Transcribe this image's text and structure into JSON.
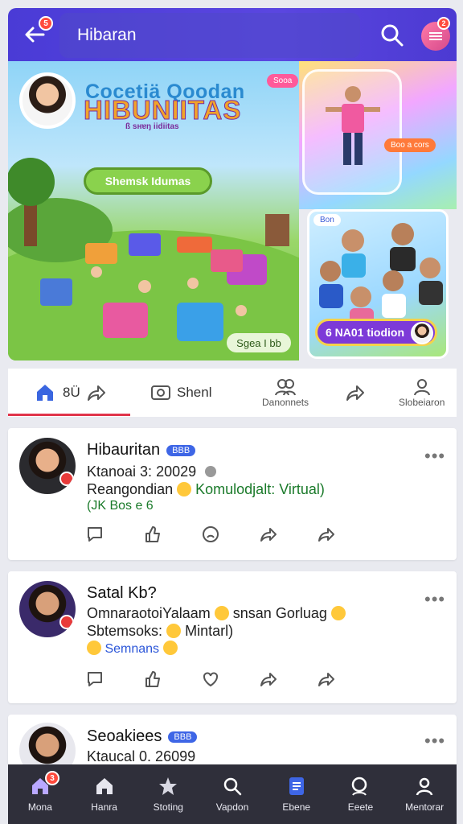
{
  "header": {
    "title": "Hibaran",
    "back_badge": "5",
    "menu_badge": "2",
    "icons": [
      "back-arrow-icon",
      "search-icon",
      "menu-icon"
    ]
  },
  "hero": {
    "title_line1": "Cocetiä Qoodan",
    "title_line2": "HIBUNIITAS",
    "subtitle": "ß sʜɐŋ iidiitas",
    "speech_button": "Shemsk Idumas",
    "chip": "Sgea I bb",
    "side_tag_top": "Sooa",
    "side_tag_bottom": "Boo a cors",
    "people_pill": "6 NA01 tiodion",
    "side_badge": "Bon"
  },
  "tabs": {
    "home_label": "8Ü",
    "shenl_label": "Shenl",
    "danonnets_label": "Danonnets",
    "slobeiaron_label": "Slobeiaron"
  },
  "posts": [
    {
      "name": "Hibauritan",
      "badge": "BBB",
      "date": "Ktanoai 3: 20029",
      "line1_a": "Reangondian",
      "line1_b": "Komulodjalt: Virtual)",
      "line2": "(JK Bos e 6"
    },
    {
      "name": "Satal Kb?",
      "line0_a": "OmnaraotoiYalaam",
      "line0_b": "snsan Gorluag",
      "line1_a": "Sbtemsoks:",
      "line1_b": "Mintarl)",
      "line2": "Semnans"
    },
    {
      "name": "Seoakiees",
      "badge": "BBB",
      "date": "Ktaucal 0. 26099"
    }
  ],
  "bottom_nav": {
    "items": [
      {
        "label": "Mona",
        "icon": "home-icon",
        "badge": "3"
      },
      {
        "label": "Hanra",
        "icon": "house-icon"
      },
      {
        "label": "Stoting",
        "icon": "star-icon"
      },
      {
        "label": "Vapdon",
        "icon": "search-icon"
      },
      {
        "label": "Ebene",
        "icon": "document-icon"
      },
      {
        "label": "Eeete",
        "icon": "search-person-icon"
      },
      {
        "label": "Mentorar",
        "icon": "profile-icon"
      }
    ]
  },
  "colors": {
    "header": "#5140dc",
    "accent_red": "#e0344a",
    "badge_blue": "#3e66e6",
    "nav_bg": "#2f2f3a"
  }
}
